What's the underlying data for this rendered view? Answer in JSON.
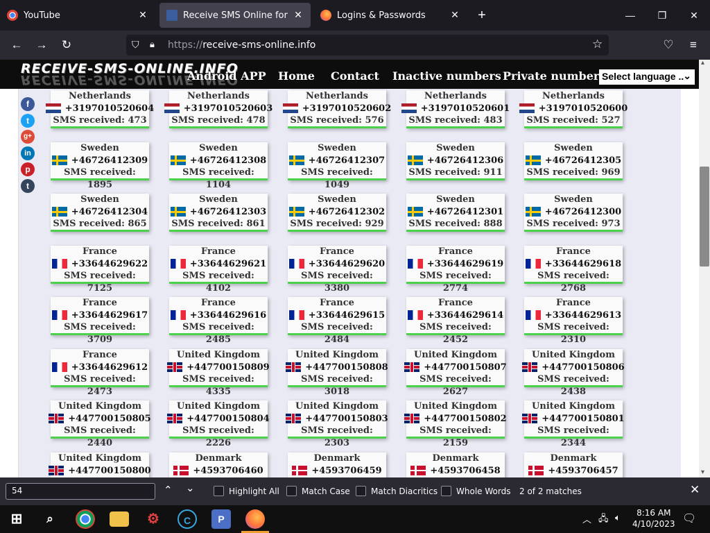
{
  "browser": {
    "tabs": [
      {
        "title": "YouTube"
      },
      {
        "title": "Receive SMS Online for FREE - U"
      },
      {
        "title": "Logins & Passwords"
      }
    ],
    "url_prefix": "https://",
    "url_domain": "receive-sms-online.info"
  },
  "site": {
    "logo": "RECEIVE-SMS-ONLINE.INFO",
    "nav": [
      "Android APP",
      "Home",
      "Contact",
      "Inactive numbers",
      "Private numbers"
    ],
    "language_select": "Select language ..",
    "sms_label": "SMS received:"
  },
  "cards": [
    {
      "country": "Netherlands",
      "flag": "nl",
      "number": "+3197010520604",
      "count": "473"
    },
    {
      "country": "Netherlands",
      "flag": "nl",
      "number": "+3197010520603",
      "count": "478"
    },
    {
      "country": "Netherlands",
      "flag": "nl",
      "number": "+3197010520602",
      "count": "576"
    },
    {
      "country": "Netherlands",
      "flag": "nl",
      "number": "+3197010520601",
      "count": "483"
    },
    {
      "country": "Netherlands",
      "flag": "nl",
      "number": "+3197010520600",
      "count": "527"
    },
    {
      "country": "Sweden",
      "flag": "se",
      "number": "+46726412309",
      "count": "1895"
    },
    {
      "country": "Sweden",
      "flag": "se",
      "number": "+46726412308",
      "count": "1104"
    },
    {
      "country": "Sweden",
      "flag": "se",
      "number": "+46726412307",
      "count": "1049"
    },
    {
      "country": "Sweden",
      "flag": "se",
      "number": "+46726412306",
      "count": "911"
    },
    {
      "country": "Sweden",
      "flag": "se",
      "number": "+46726412305",
      "count": "969"
    },
    {
      "country": "Sweden",
      "flag": "se",
      "number": "+46726412304",
      "count": "865"
    },
    {
      "country": "Sweden",
      "flag": "se",
      "number": "+46726412303",
      "count": "861"
    },
    {
      "country": "Sweden",
      "flag": "se",
      "number": "+46726412302",
      "count": "929"
    },
    {
      "country": "Sweden",
      "flag": "se",
      "number": "+46726412301",
      "count": "888"
    },
    {
      "country": "Sweden",
      "flag": "se",
      "number": "+46726412300",
      "count": "973"
    },
    {
      "country": "France",
      "flag": "fr",
      "number": "+33644629622",
      "count": "7125"
    },
    {
      "country": "France",
      "flag": "fr",
      "number": "+33644629621",
      "count": "4102"
    },
    {
      "country": "France",
      "flag": "fr",
      "number": "+33644629620",
      "count": "3380"
    },
    {
      "country": "France",
      "flag": "fr",
      "number": "+33644629619",
      "count": "2774"
    },
    {
      "country": "France",
      "flag": "fr",
      "number": "+33644629618",
      "count": "2768"
    },
    {
      "country": "France",
      "flag": "fr",
      "number": "+33644629617",
      "count": "3709"
    },
    {
      "country": "France",
      "flag": "fr",
      "number": "+33644629616",
      "count": "2485"
    },
    {
      "country": "France",
      "flag": "fr",
      "number": "+33644629615",
      "count": "2484"
    },
    {
      "country": "France",
      "flag": "fr",
      "number": "+33644629614",
      "count": "2452"
    },
    {
      "country": "France",
      "flag": "fr",
      "number": "+33644629613",
      "count": "2310"
    },
    {
      "country": "France",
      "flag": "fr",
      "number": "+33644629612",
      "count": "2473"
    },
    {
      "country": "United Kingdom",
      "flag": "uk",
      "number": "+447700150809",
      "count": "4335"
    },
    {
      "country": "United Kingdom",
      "flag": "uk",
      "number": "+447700150808",
      "count": "3018"
    },
    {
      "country": "United Kingdom",
      "flag": "uk",
      "number": "+447700150807",
      "count": "2627"
    },
    {
      "country": "United Kingdom",
      "flag": "uk",
      "number": "+447700150806",
      "count": "2438"
    },
    {
      "country": "United Kingdom",
      "flag": "uk",
      "number": "+447700150805",
      "count": "2440"
    },
    {
      "country": "United Kingdom",
      "flag": "uk",
      "number": "+447700150804",
      "count": "2226"
    },
    {
      "country": "United Kingdom",
      "flag": "uk",
      "number": "+447700150803",
      "count": "2303"
    },
    {
      "country": "United Kingdom",
      "flag": "uk",
      "number": "+447700150802",
      "count": "2159"
    },
    {
      "country": "United Kingdom",
      "flag": "uk",
      "number": "+447700150801",
      "count": "2344"
    },
    {
      "country": "United Kingdom",
      "flag": "uk",
      "number": "+447700150800",
      "count": ""
    },
    {
      "country": "Denmark",
      "flag": "dk",
      "number": "+4593706460",
      "count": ""
    },
    {
      "country": "Denmark",
      "flag": "dk",
      "number": "+4593706459",
      "count": ""
    },
    {
      "country": "Denmark",
      "flag": "dk",
      "number": "+4593706458",
      "count": ""
    },
    {
      "country": "Denmark",
      "flag": "dk",
      "number": "+4593706457",
      "count": ""
    }
  ],
  "share_icons": [
    "facebook-icon",
    "twitter-icon",
    "google-plus-icon",
    "linkedin-icon",
    "pinterest-icon",
    "tumblr-icon"
  ],
  "findbar": {
    "query": "54",
    "highlight_all": "Highlight All",
    "match_case": "Match Case",
    "match_diacritics": "Match Diacritics",
    "whole_words": "Whole Words",
    "status": "2 of 2 matches"
  },
  "taskbar": {
    "time": "8:16 AM",
    "date": "4/10/2023"
  },
  "colors": {
    "accent_green": "#4cd14c",
    "page_bg": "#eaeaf5",
    "nav_bg": "#0d0d0d"
  }
}
